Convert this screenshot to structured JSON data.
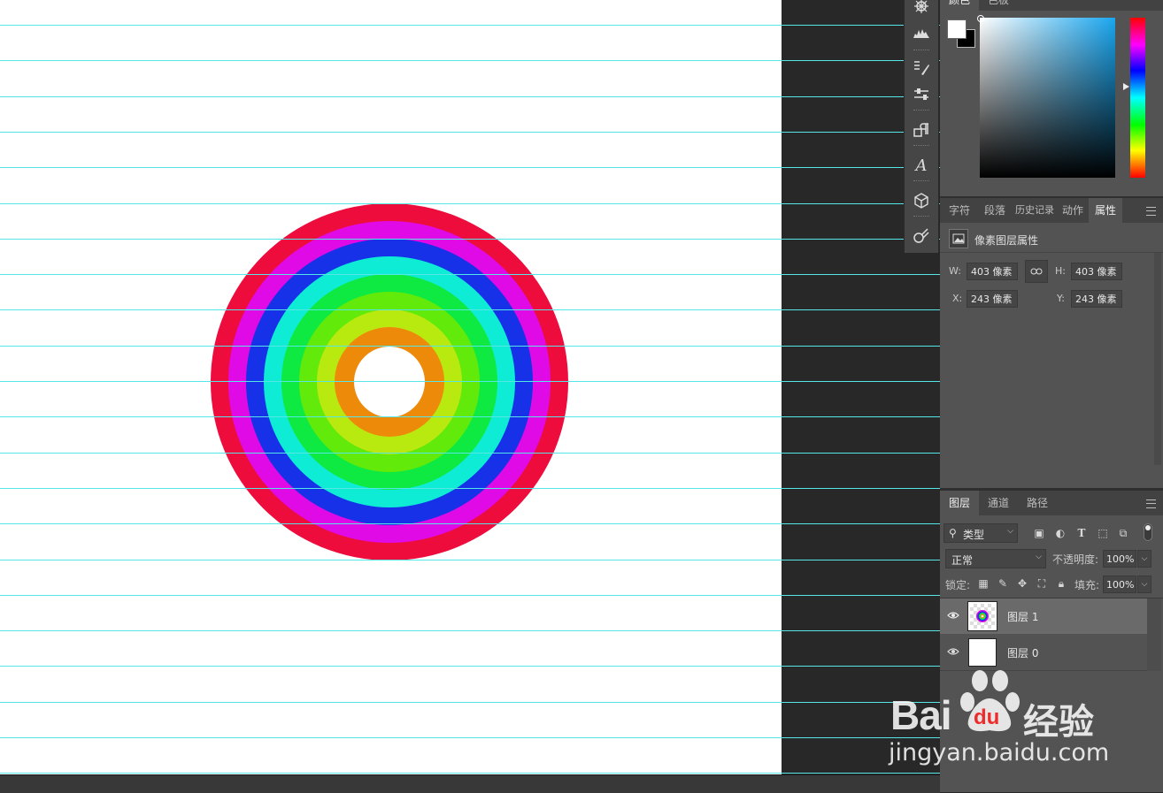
{
  "colors": {
    "guide": "#55e6e6",
    "ring_colors": [
      "#ee0c3c",
      "#df0ae5",
      "#1631e8",
      "#0eecd5",
      "#0eea42",
      "#62ea0a",
      "#b8ea10",
      "#ee8a0a"
    ]
  },
  "color_panel": {
    "tabs": [
      "颜色",
      "色板"
    ]
  },
  "properties_panel": {
    "tabs": [
      "字符",
      "段落",
      "历史记录",
      "动作",
      "属性"
    ],
    "active_tab": "属性",
    "title": "像素图层属性",
    "w_label": "W:",
    "w_value": "403 像素",
    "h_label": "H:",
    "h_value": "403 像素",
    "x_label": "X:",
    "x_value": "243 像素",
    "y_label": "Y:",
    "y_value": "243 像素"
  },
  "layers_panel": {
    "tabs": [
      "图层",
      "通道",
      "路径"
    ],
    "filter_value": "类型",
    "blend_mode": "正常",
    "opacity_label": "不透明度:",
    "opacity_value": "100%",
    "lock_label": "锁定:",
    "fill_label": "填充:",
    "fill_value": "100%",
    "layers": [
      {
        "name": "图层 1",
        "selected": true
      },
      {
        "name": "图层 0",
        "selected": false
      }
    ]
  },
  "icons": [
    "ring-panel-icon",
    "histogram-icon",
    "brush-presets-icon",
    "brush-settings-icon",
    "paragraph-styles-icon",
    "character-styles-icon",
    "3d-icon",
    "clone-source-icon"
  ],
  "watermark": {
    "text": "Bai",
    "text2": "du",
    "brand": "经验",
    "url": "jingyan.baidu.com"
  }
}
